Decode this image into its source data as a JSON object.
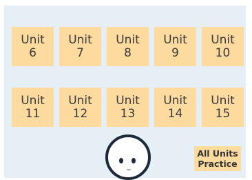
{
  "units": [
    {
      "word": "Unit",
      "num": "6"
    },
    {
      "word": "Unit",
      "num": "7"
    },
    {
      "word": "Unit",
      "num": "8"
    },
    {
      "word": "Unit",
      "num": "9"
    },
    {
      "word": "Unit",
      "num": "10"
    },
    {
      "word": "Unit",
      "num": "11"
    },
    {
      "word": "Unit",
      "num": "12"
    },
    {
      "word": "Unit",
      "num": "13"
    },
    {
      "word": "Unit",
      "num": "14"
    },
    {
      "word": "Unit",
      "num": "15"
    }
  ],
  "all_units": {
    "line1": "All Units",
    "line2": "Practice"
  },
  "colors": {
    "panel": "#e6eef6",
    "tile": "#fddb9f",
    "avatar_outline": "#1c2a3a"
  }
}
